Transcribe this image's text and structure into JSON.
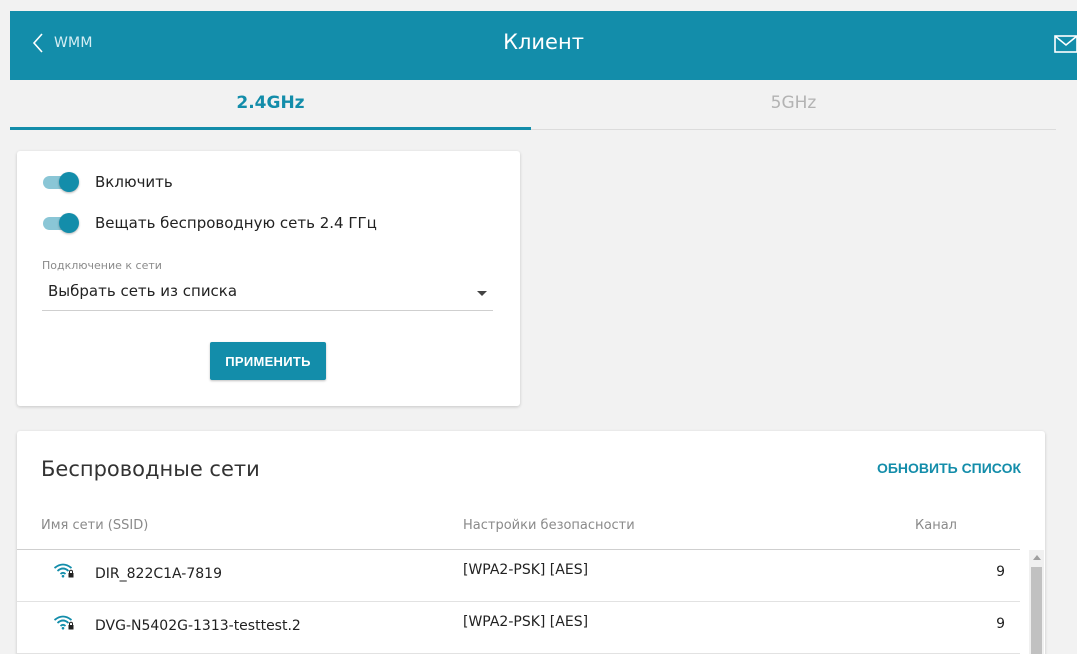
{
  "header": {
    "back_label": "WMM",
    "title": "Клиент",
    "accent_color": "#138daa"
  },
  "tabs": [
    {
      "label": "2.4GHz",
      "active": true
    },
    {
      "label": "5GHz",
      "active": false
    }
  ],
  "settings": {
    "enable_label": "Включить",
    "enable_on": true,
    "broadcast_label": "Вещать беспроводную сеть 2.4 ГГц",
    "broadcast_on": true,
    "connection_caption": "Подключение к сети",
    "connection_value": "Выбрать сеть из списка",
    "apply_label": "ПРИМЕНИТЬ"
  },
  "networks": {
    "title": "Беспроводные сети",
    "refresh_label": "ОБНОВИТЬ СПИСОК",
    "columns": {
      "ssid": "Имя сети (SSID)",
      "security": "Настройки безопасности",
      "channel": "Канал"
    },
    "rows": [
      {
        "icon": "wifi-lock-icon",
        "ssid": "DIR_822C1A-7819",
        "security": "[WPA2-PSK] [AES]",
        "channel": "9"
      },
      {
        "icon": "wifi-lock-icon",
        "ssid": "DVG-N5402G-1313-testtest.2",
        "security": "[WPA2-PSK] [AES]",
        "channel": "9"
      }
    ]
  }
}
